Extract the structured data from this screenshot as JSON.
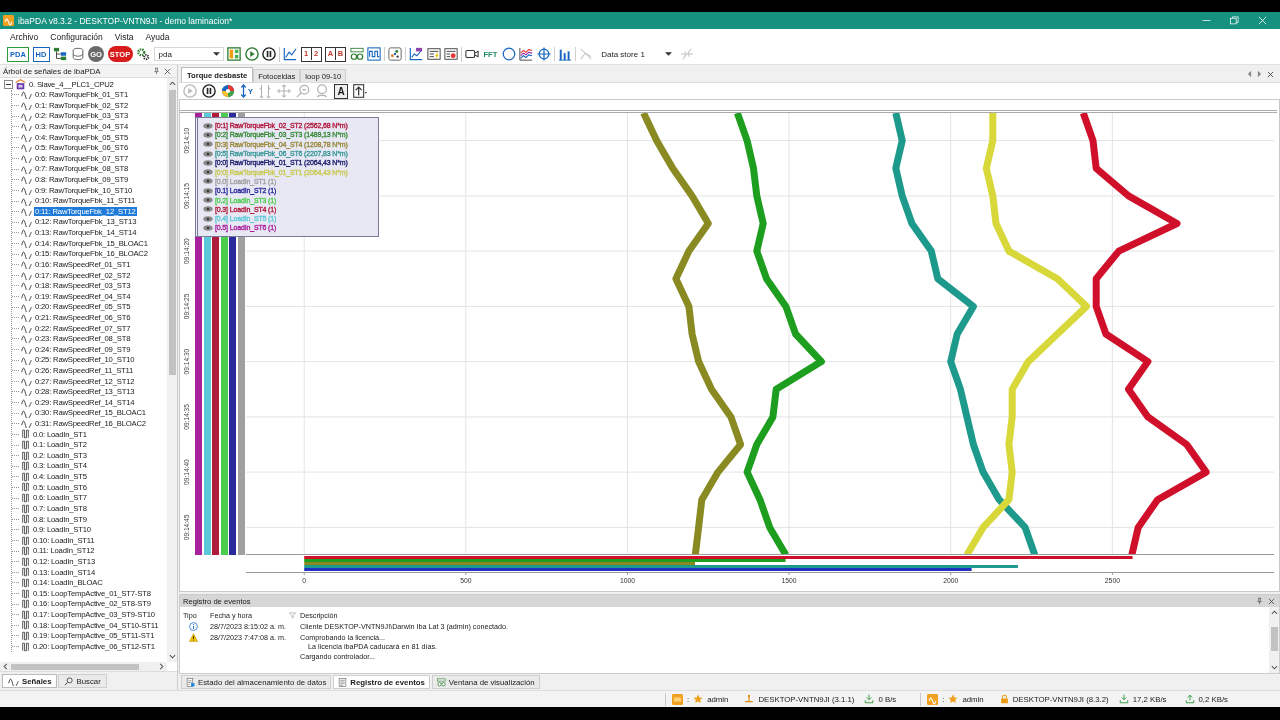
{
  "window": {
    "title": "ibaPDA v8.3.2 - DESKTOP-VNTN9JI - demo laminacion*"
  },
  "menu": [
    "Archivo",
    "Configuración",
    "Vista",
    "Ayuda"
  ],
  "toolbar": {
    "groups": [
      [
        {
          "kind": "pda",
          "text": "PDA",
          "disabled": false
        },
        {
          "kind": "hd",
          "text": "HD",
          "disabled": false
        },
        {
          "kind": "tree",
          "disabled": false
        },
        {
          "kind": "db",
          "disabled": false
        },
        {
          "kind": "go",
          "text": "GO",
          "disabled": true
        },
        {
          "kind": "stop",
          "text": "STOP",
          "disabled": false
        },
        {
          "kind": "gears",
          "disabled": false
        },
        {
          "kind": "combo",
          "value": "pda",
          "disabled": false
        },
        {
          "kind": "layout",
          "disabled": false
        },
        {
          "kind": "play",
          "disabled": false
        },
        {
          "kind": "pause",
          "disabled": false
        }
      ],
      [
        {
          "kind": "line-chart",
          "disabled": false
        },
        {
          "kind": "cells",
          "cells": [
            "1",
            "2"
          ],
          "disabled": false
        },
        {
          "kind": "cells",
          "cells": [
            "A",
            "B"
          ],
          "disabled": false
        },
        {
          "kind": "glasses",
          "disabled": false
        },
        {
          "kind": "square-wave",
          "disabled": false
        }
      ],
      [
        {
          "kind": "scatter",
          "disabled": false
        }
      ],
      [
        {
          "kind": "hd-chart",
          "disabled": false
        },
        {
          "kind": "list-flash",
          "disabled": false
        },
        {
          "kind": "list-red",
          "disabled": false
        }
      ],
      [
        {
          "kind": "camera",
          "disabled": false
        },
        {
          "kind": "fft",
          "text": "FFT",
          "disabled": false
        },
        {
          "kind": "ellipse",
          "disabled": false
        },
        {
          "kind": "waterfall",
          "disabled": false
        },
        {
          "kind": "crosshair",
          "disabled": false
        }
      ],
      [
        {
          "kind": "bars",
          "disabled": false
        }
      ],
      [
        {
          "kind": "store-off",
          "disabled": true
        },
        {
          "kind": "combo",
          "value": "Data store 1",
          "disabled": false
        },
        {
          "kind": "disconnect",
          "disabled": true
        }
      ]
    ]
  },
  "signal_tree": {
    "title": "Árbol de señales de ibaPDA",
    "root": {
      "label": "0. Slave_4__PLC1_CPU2",
      "expanded": true,
      "children": [
        {
          "label": "0:0: RawTorqueFbk_01_ST1",
          "kind": "analog",
          "selected": false
        },
        {
          "label": "0:1: RawTorqueFbk_02_ST2",
          "kind": "analog",
          "selected": false
        },
        {
          "label": "0:2: RawTorqueFbk_03_ST3",
          "kind": "analog",
          "selected": false
        },
        {
          "label": "0:3: RawTorqueFbk_04_ST4",
          "kind": "analog",
          "selected": false
        },
        {
          "label": "0:4: RawTorqueFbk_05_ST5",
          "kind": "analog",
          "selected": false
        },
        {
          "label": "0:5: RawTorqueFbk_06_ST6",
          "kind": "analog",
          "selected": false
        },
        {
          "label": "0:6: RawTorqueFbk_07_ST7",
          "kind": "analog",
          "selected": false
        },
        {
          "label": "0:7: RawTorqueFbk_08_ST8",
          "kind": "analog",
          "selected": false
        },
        {
          "label": "0:8: RawTorqueFbk_09_ST9",
          "kind": "analog",
          "selected": false
        },
        {
          "label": "0:9: RawTorqueFbk_10_ST10",
          "kind": "analog",
          "selected": false
        },
        {
          "label": "0:10: RawTorqueFbk_11_ST11",
          "kind": "analog",
          "selected": false
        },
        {
          "label": "0:11: RawTorqueFbk_12_ST12",
          "kind": "analog",
          "selected": true
        },
        {
          "label": "0:12: RawTorqueFbk_13_ST13",
          "kind": "analog",
          "selected": false
        },
        {
          "label": "0:13: RawTorqueFbk_14_ST14",
          "kind": "analog",
          "selected": false
        },
        {
          "label": "0:14: RawTorqueFbk_15_BLOAC1",
          "kind": "analog",
          "selected": false
        },
        {
          "label": "0:15: RawTorqueFbk_16_BLOAC2",
          "kind": "analog",
          "selected": false
        },
        {
          "label": "0:16: RawSpeedRef_01_ST1",
          "kind": "analog",
          "selected": false
        },
        {
          "label": "0:17: RawSpeedRef_02_ST2",
          "kind": "analog",
          "selected": false
        },
        {
          "label": "0:18: RawSpeedRef_03_ST3",
          "kind": "analog",
          "selected": false
        },
        {
          "label": "0:19: RawSpeedRef_04_ST4",
          "kind": "analog",
          "selected": false
        },
        {
          "label": "0:20: RawSpeedRef_05_ST5",
          "kind": "analog",
          "selected": false
        },
        {
          "label": "0:21: RawSpeedRef_06_ST6",
          "kind": "analog",
          "selected": false
        },
        {
          "label": "0:22: RawSpeedRef_07_ST7",
          "kind": "analog",
          "selected": false
        },
        {
          "label": "0:23: RawSpeedRef_08_ST8",
          "kind": "analog",
          "selected": false
        },
        {
          "label": "0:24: RawSpeedRef_09_ST9",
          "kind": "analog",
          "selected": false
        },
        {
          "label": "0:25: RawSpeedRef_10_ST10",
          "kind": "analog",
          "selected": false
        },
        {
          "label": "0:26: RawSpeedRef_11_ST11",
          "kind": "analog",
          "selected": false
        },
        {
          "label": "0:27: RawSpeedRef_12_ST12",
          "kind": "analog",
          "selected": false
        },
        {
          "label": "0:28: RawSpeedRef_13_ST13",
          "kind": "analog",
          "selected": false
        },
        {
          "label": "0:29: RawSpeedRef_14_ST14",
          "kind": "analog",
          "selected": false
        },
        {
          "label": "0:30: RawSpeedRef_15_BLOAC1",
          "kind": "analog",
          "selected": false
        },
        {
          "label": "0:31: RawSpeedRef_16_BLOAC2",
          "kind": "analog",
          "selected": false
        },
        {
          "label": "0.0: LoadIn_ST1",
          "kind": "digital",
          "selected": false
        },
        {
          "label": "0.1: LoadIn_ST2",
          "kind": "digital",
          "selected": false
        },
        {
          "label": "0.2: LoadIn_ST3",
          "kind": "digital",
          "selected": false
        },
        {
          "label": "0.3: LoadIn_ST4",
          "kind": "digital",
          "selected": false
        },
        {
          "label": "0.4: LoadIn_ST5",
          "kind": "digital",
          "selected": false
        },
        {
          "label": "0.5: LoadIn_ST6",
          "kind": "digital",
          "selected": false
        },
        {
          "label": "0.6: LoadIn_ST7",
          "kind": "digital",
          "selected": false
        },
        {
          "label": "0.7: LoadIn_ST8",
          "kind": "digital",
          "selected": false
        },
        {
          "label": "0.8: LoadIn_ST9",
          "kind": "digital",
          "selected": false
        },
        {
          "label": "0.9: LoadIn_ST10",
          "kind": "digital",
          "selected": false
        },
        {
          "label": "0.10: LoadIn_ST11",
          "kind": "digital",
          "selected": false
        },
        {
          "label": "0.11: LoadIn_ST12",
          "kind": "digital",
          "selected": false
        },
        {
          "label": "0.12: LoadIn_ST13",
          "kind": "digital",
          "selected": false
        },
        {
          "label": "0.13: LoadIn_ST14",
          "kind": "digital",
          "selected": false
        },
        {
          "label": "0.14: LoadIn_BLOAC",
          "kind": "digital",
          "selected": false
        },
        {
          "label": "0.15: LoopTempActive_01_ST7-ST8",
          "kind": "digital",
          "selected": false
        },
        {
          "label": "0.16: LoopTempActive_02_ST8-ST9",
          "kind": "digital",
          "selected": false
        },
        {
          "label": "0.17: LoopTempActive_03_ST9-ST10",
          "kind": "digital",
          "selected": false
        },
        {
          "label": "0.18: LoopTempActive_04_ST10-ST11",
          "kind": "digital",
          "selected": false
        },
        {
          "label": "0.19: LoopTempActive_05_ST11-ST1",
          "kind": "digital",
          "selected": false
        },
        {
          "label": "0.20: LoopTempActive_06_ST12-ST1",
          "kind": "digital",
          "selected": false
        }
      ]
    },
    "tabs": [
      {
        "label": "Señales",
        "kind": "signals",
        "selected": true
      },
      {
        "label": "Buscar",
        "kind": "search",
        "selected": false
      }
    ]
  },
  "document_tabs": [
    {
      "label": "Torque desbaste",
      "selected": true
    },
    {
      "label": "Fotoceldas",
      "selected": false
    },
    {
      "label": "loop 09-10",
      "selected": false
    }
  ],
  "view_toolbar": {
    "items": [
      {
        "kind": "play",
        "disabled": true
      },
      {
        "kind": "pause",
        "disabled": false
      },
      {
        "kind": "color-wheel",
        "disabled": false
      },
      {
        "kind": "axis-scale",
        "text": "Y",
        "disabled": false
      },
      {
        "kind": "marker",
        "disabled": true
      },
      {
        "kind": "move",
        "disabled": true
      },
      {
        "kind": "zoom-in",
        "disabled": true
      },
      {
        "kind": "zoom-out",
        "disabled": true
      },
      {
        "kind": "letter",
        "text": "A",
        "disabled": false
      },
      {
        "kind": "export",
        "disabled": false
      }
    ]
  },
  "chart": {
    "legend": [
      {
        "label": "[0:1] RawTorqueFbk_02_ST2 (2562,68 N*m)",
        "kind": "analog",
        "color": "#b0183c"
      },
      {
        "label": "[0:2] RawTorqueFbk_03_ST3 (1489,13 N*m)",
        "kind": "analog",
        "color": "#3a8c3a"
      },
      {
        "label": "[0:3] RawTorqueFbk_04_ST4 (1208,78 N*m)",
        "kind": "analog",
        "color": "#9a8a3a"
      },
      {
        "label": "[0:5] RawTorqueFbk_06_ST6 (2207,83 N*m)",
        "kind": "analog",
        "color": "#3a9898"
      },
      {
        "label": "[0:0] RawTorqueFbk_01_ST1 (2064,43 N*m)",
        "kind": "analog",
        "color": "#1c1c6c"
      },
      {
        "label": "[0:0] RawTorqueFbk_01_ST1 (2064,43 N*m)",
        "kind": "analog",
        "color": "#c8c850"
      },
      {
        "label": "[0.0] LoadIn_ST1 (1)",
        "kind": "digital",
        "color": "#a0a0a0"
      },
      {
        "label": "[0.1] LoadIn_ST2 (1)",
        "kind": "digital",
        "color": "#2a2a9a"
      },
      {
        "label": "[0.2] LoadIn_ST3 (1)",
        "kind": "digital",
        "color": "#4ccc4c"
      },
      {
        "label": "[0.3] LoadIn_ST4 (1)",
        "kind": "digital",
        "color": "#b01c3c"
      },
      {
        "label": "[0.4] LoadIn_ST5 (1)",
        "kind": "digital",
        "color": "#5cc8d8"
      },
      {
        "label": "[0.5] LoadIn_ST6 (1)",
        "kind": "digital",
        "color": "#a8209c"
      }
    ],
    "chart_data": [
      {
        "type": "line",
        "orientation": "horizontal",
        "x": [
          9.2354167,
          9.2361111,
          9.2368056,
          9.2375,
          9.2381944,
          9.2388889,
          9.2395833,
          9.2402778,
          9.2409722,
          9.2416667,
          9.2423611,
          9.2430556,
          9.24375,
          9.2444444,
          9.2451389,
          9.2458333,
          9.2465278
        ],
        "ylim": [
          9.2465278,
          9.2354167
        ],
        "yticks": [
          {
            "value": 9.2361111,
            "label": "09:14:10"
          },
          {
            "value": 9.2375,
            "label": "09:14:15"
          },
          {
            "value": 9.2388889,
            "label": "09:14:20"
          },
          {
            "value": 9.2402778,
            "label": "09:14:25"
          },
          {
            "value": 9.2416667,
            "label": "09:14:30"
          },
          {
            "value": 9.2430556,
            "label": "09:14:35"
          },
          {
            "value": 9.2444444,
            "label": "09:14:40"
          },
          {
            "value": 9.2458333,
            "label": "09:14:45"
          }
        ],
        "xlim": [
          -180,
          3000
        ],
        "xticks": [
          0,
          500,
          1000,
          1500,
          2000,
          2500
        ],
        "tick_labels": "y",
        "grid": true,
        "series": [
          {
            "color": "#d0102a",
            "values": [
              2410,
              2440,
              2450,
              2550,
              2700,
              2520,
              2450,
              2450,
              2480,
              2610,
              2550,
              2610,
              2730,
              2790,
              2640,
              2580,
              2560
            ]
          },
          {
            "color": "#1e9e1e",
            "values": [
              1340,
              1370,
              1390,
              1400,
              1420,
              1400,
              1430,
              1490,
              1520,
              1600,
              1460,
              1450,
              1400,
              1370,
              1410,
              1440,
              1490
            ]
          },
          {
            "color": "#8a8a22",
            "values": [
              1050,
              1090,
              1140,
              1200,
              1250,
              1190,
              1150,
              1190,
              1200,
              1220,
              1260,
              1320,
              1350,
              1280,
              1230,
              1220,
              1210
            ]
          },
          {
            "color": "#1e9a8c",
            "values": [
              1830,
              1850,
              1830,
              1850,
              1880,
              1940,
              1960,
              2070,
              2020,
              2000,
              2030,
              2050,
              2070,
              2100,
              2150,
              2230,
              2260
            ]
          },
          {
            "color": "#d8d83a",
            "values": [
              2130,
              2130,
              2110,
              2130,
              2140,
              2180,
              2330,
              2420,
              2330,
              2240,
              2190,
              2190,
              2180,
              2190,
              2180,
              2100,
              2050
            ]
          }
        ]
      },
      {
        "type": "bar",
        "orientation": "horizontal",
        "categories": [
          null,
          null,
          null,
          null,
          null
        ],
        "values": [
          2562.68,
          1489.13,
          1208.78,
          2207.83,
          2064.43
        ],
        "colors": [
          "#d0102a",
          "#1e9e1e",
          "#8a8a22",
          "#1e9a8c",
          "#2030c0"
        ],
        "xlim": [
          -180,
          3000
        ],
        "xticks": [
          0,
          500,
          1000,
          1500,
          2000,
          2500
        ]
      }
    ]
  },
  "event_log": {
    "title": "Registro de eventos",
    "columns": [
      "Tipo",
      "Fecha y hora",
      "Descripción"
    ],
    "rows": [
      {
        "kind": "info",
        "time": "28/7/2023 8:15:02 a. m.",
        "description": [
          {
            "text": "Cliente DESKTOP-VNTN9JI\\Darwin Iba Lat 3 (admin) conectado."
          }
        ]
      },
      {
        "kind": "warning",
        "time": "28/7/2023 7:47:08 a. m.",
        "description": [
          {
            "text": "Comprobando la licencia...",
            "children": [
              {
                "text": "La licencia ibaPDA caducará en 81 días."
              }
            ]
          },
          {
            "text": "Cargando controlador..."
          }
        ]
      }
    ]
  },
  "bottom_tabs": [
    {
      "label": "Estado del almacenamiento de datos",
      "kind": "storage",
      "selected": false
    },
    {
      "label": "Registro de eventos",
      "kind": "events",
      "selected": true
    },
    {
      "label": "Ventana de visualización",
      "kind": "view",
      "selected": false
    }
  ],
  "status_bar": {
    "servers": [
      {
        "kind": "hd",
        "label": ":",
        "user": "admin",
        "host": "DESKTOP-VNTN9JI (3.1.1)",
        "rates": [
          {
            "kind": "download",
            "text": "0 B/s"
          }
        ]
      },
      {
        "kind": "pda",
        "label": ":",
        "user": "admin",
        "host": "DESKTOP-VNTN9JI (8.3.2)",
        "rates": [
          {
            "kind": "download",
            "text": "17,2 KB/s"
          },
          {
            "kind": "upload",
            "text": "0,2 KB/s"
          }
        ]
      }
    ]
  }
}
